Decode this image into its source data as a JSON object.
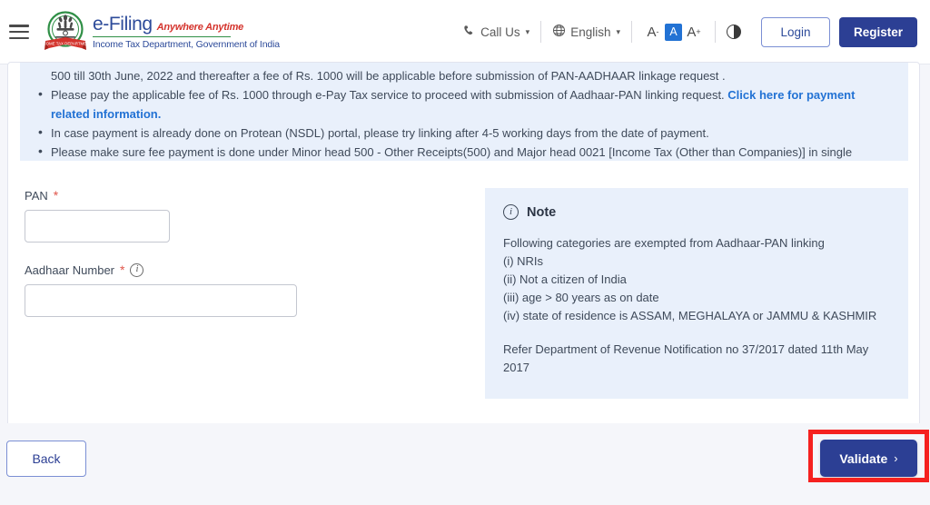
{
  "header": {
    "menu_icon": "hamburger-menu-icon",
    "brand": {
      "emblem_icon": "india-national-emblem-icon",
      "title": "e-Filing",
      "tagline": "Anywhere Anytime",
      "subtitle": "Income Tax Department, Government of India"
    },
    "call_us": {
      "icon": "phone-icon",
      "label": "Call Us",
      "caret": "⌄"
    },
    "language": {
      "icon": "globe-icon",
      "label": "English",
      "caret": "⌄"
    },
    "font_controls": {
      "decrease": "A",
      "decrease_sup": "-",
      "normal": "A",
      "increase": "A",
      "increase_sup": "+",
      "contrast_icon": "contrast-toggle-icon"
    },
    "login_label": "Login",
    "register_label": "Register",
    "accent_color": "#2c3f94"
  },
  "notice": {
    "continuation": "500 till 30th June, 2022 and thereafter a fee of Rs. 1000 will be applicable before submission of PAN-AADHAAR linkage request .",
    "bullets": [
      {
        "text_before": "Please pay the applicable fee of Rs. 1000 through e-Pay Tax service to proceed with submission of Aadhaar-PAN linking request. ",
        "link": "Click here for payment related information.",
        "text_after": ""
      },
      {
        "text_before": "In case payment is already done on Protean (NSDL) portal, please try linking after 4-5 working days from the date of payment.",
        "link": "",
        "text_after": ""
      },
      {
        "text_before": "Please make sure fee payment is done under Minor head 500 - Other Receipts(500) and Major head 0021 [Income Tax (Other than Companies)] in single challan.",
        "link": "",
        "text_after": ""
      }
    ],
    "background_color": "#e9f0fb",
    "link_color": "#2272d4"
  },
  "form": {
    "pan": {
      "label": "PAN",
      "required_mark": "*",
      "value": "",
      "placeholder": ""
    },
    "aadhaar": {
      "label": "Aadhaar Number",
      "required_mark": "*",
      "info_icon": "info-circle-icon",
      "value": "",
      "placeholder": ""
    }
  },
  "note": {
    "icon": "info-circle-icon",
    "title": "Note",
    "lines": [
      "Following categories are exempted from Aadhaar-PAN linking",
      "(i) NRIs",
      "(ii) Not a citizen of India",
      "(iii) age > 80 years as on date",
      "(iv) state of residence is ASSAM, MEGHALAYA or JAMMU & KASHMIR"
    ],
    "reference": "Refer Department of Revenue Notification no 37/2017 dated 11th May 2017",
    "background_color": "#e9f0fb"
  },
  "footer": {
    "back_label": "Back",
    "validate_label": "Validate",
    "validate_chevron": "›",
    "highlight_color": "#f5211f"
  }
}
